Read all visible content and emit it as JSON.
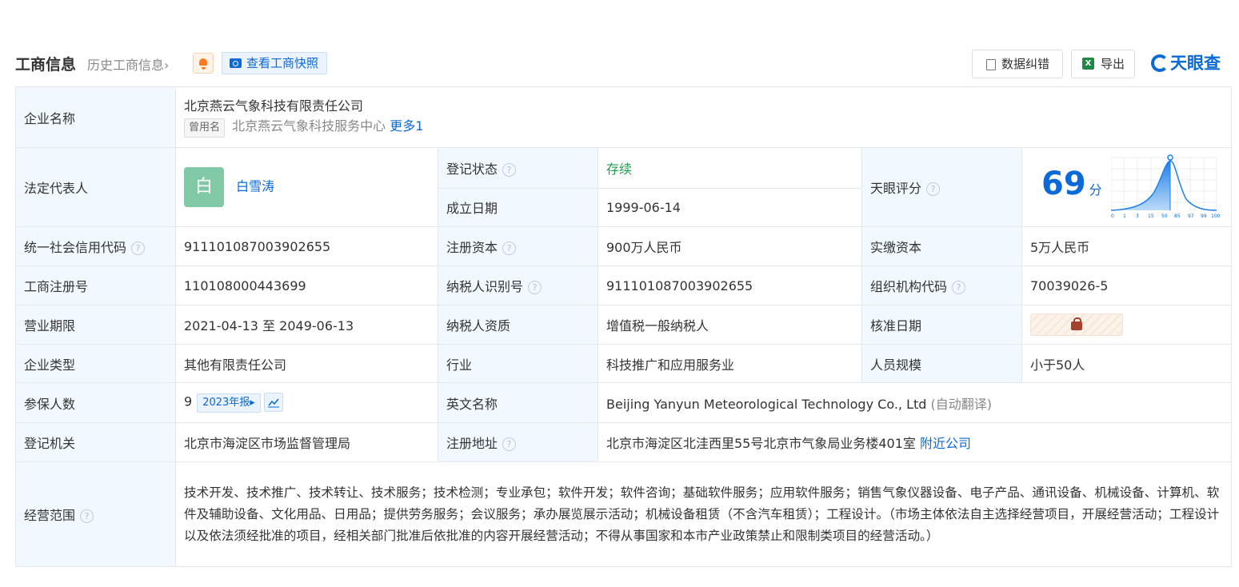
{
  "header": {
    "title": "工商信息",
    "history_link": "历史工商信息",
    "snapshot_button": "查看工商快照",
    "fix_button": "数据纠错",
    "export_button": "导出",
    "export_icon_text": "X",
    "logo_text": "天眼查",
    "chevron": "›"
  },
  "company": {
    "name_label": "企业名称",
    "name": "北京燕云气象科技有限责任公司",
    "former_tag": "曾用名",
    "former_name": "北京燕云气象科技服务中心",
    "more_link": "更多1"
  },
  "legal_rep": {
    "label": "法定代表人",
    "avatar_char": "白",
    "name": "白雪涛"
  },
  "status": {
    "label": "登记状态",
    "value": "存续"
  },
  "founded": {
    "label": "成立日期",
    "value": "1999-06-14"
  },
  "score": {
    "label": "天眼评分",
    "value": "69",
    "unit": "分"
  },
  "credit_code": {
    "label": "统一社会信用代码",
    "value": "911101087003902655"
  },
  "reg_capital": {
    "label": "注册资本",
    "value": "900万人民币"
  },
  "paid_capital": {
    "label": "实缴资本",
    "value": "5万人民币"
  },
  "reg_no": {
    "label": "工商注册号",
    "value": "110108000443699"
  },
  "taxpayer_id": {
    "label": "纳税人识别号",
    "value": "911101087003902655"
  },
  "org_code": {
    "label": "组织机构代码",
    "value": "70039026-5"
  },
  "term": {
    "label": "营业期限",
    "value": "2021-04-13 至 2049-06-13"
  },
  "taxpayer_type": {
    "label": "纳税人资质",
    "value": "增值税一般纳税人"
  },
  "approval_date": {
    "label": "核准日期"
  },
  "company_type": {
    "label": "企业类型",
    "value": "其他有限责任公司"
  },
  "industry": {
    "label": "行业",
    "value": "科技推广和应用服务业"
  },
  "staff_size": {
    "label": "人员规模",
    "value": "小于50人"
  },
  "insured": {
    "label": "参保人数",
    "value": "9",
    "report_button": "2023年报▸"
  },
  "english_name": {
    "label": "英文名称",
    "value": "Beijing Yanyun Meteorological Technology Co., Ltd",
    "note": "(自动翻译)"
  },
  "authority": {
    "label": "登记机关",
    "value": "北京市海淀区市场监督管理局"
  },
  "address": {
    "label": "注册地址",
    "value": "北京市海淀区北洼西里55号北京市气象局业务楼401室",
    "nearby_link": "附近公司"
  },
  "scope": {
    "label": "经营范围",
    "value": "技术开发、技术推广、技术转让、技术服务；技术检测；专业承包；软件开发；软件咨询；基础软件服务；应用软件服务；销售气象仪器设备、电子产品、通讯设备、机械设备、计算机、软件及辅助设备、文化用品、日用品；提供劳务服务；会议服务；承办展览展示活动；机械设备租赁（不含汽车租赁）；工程设计。（市场主体依法自主选择经营项目，开展经营活动；工程设计以及依法须经批准的项目，经相关部门批准后依批准的内容开展经营活动；不得从事国家和本市产业政策禁止和限制类项目的经营活动。）"
  },
  "help_glyph": "?",
  "score_chart": {
    "ticks": [
      "0",
      "1",
      "3",
      "15",
      "50",
      "85",
      "97",
      "99",
      "100"
    ]
  },
  "colors": {
    "accent": "#0b69d8",
    "label_bg": "#f2f8ff",
    "status_green": "#1e9e4d"
  }
}
